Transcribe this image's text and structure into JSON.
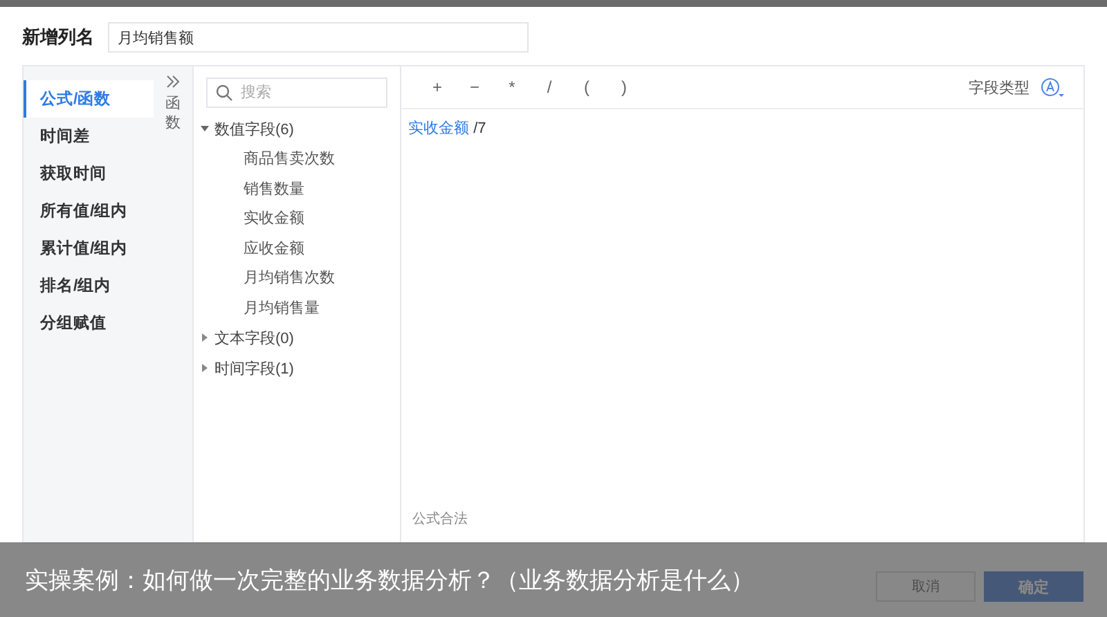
{
  "name_field": {
    "label": "新增列名",
    "value": "月均销售额"
  },
  "categories": [
    {
      "label": "公式/函数",
      "selected": true
    },
    {
      "label": "时间差",
      "selected": false
    },
    {
      "label": "获取时间",
      "selected": false
    },
    {
      "label": "所有值/组内",
      "selected": false
    },
    {
      "label": "累计值/组内",
      "selected": false
    },
    {
      "label": "排名/组内",
      "selected": false
    },
    {
      "label": "分组赋值",
      "selected": false
    }
  ],
  "function_panel": {
    "label": "函数"
  },
  "search": {
    "placeholder": "搜索"
  },
  "field_tree": [
    {
      "label": "数值字段(6)",
      "expanded": true,
      "children": [
        {
          "label": "商品售卖次数"
        },
        {
          "label": "销售数量"
        },
        {
          "label": "实收金额"
        },
        {
          "label": "应收金额"
        },
        {
          "label": "月均销售次数"
        },
        {
          "label": "月均销售量"
        }
      ]
    },
    {
      "label": "文本字段(0)",
      "expanded": false
    },
    {
      "label": "时间字段(1)",
      "expanded": false
    }
  ],
  "operators": [
    "+",
    "−",
    "*",
    "/",
    "(",
    ")"
  ],
  "field_type_label": "字段类型",
  "formula": {
    "field": "实收金额",
    "rest": "/7"
  },
  "status": "公式合法",
  "buttons": [
    {
      "label": "取消",
      "kind": "secondary"
    },
    {
      "label": "确定",
      "kind": "primary"
    }
  ],
  "caption": "实操案例：如何做一次完整的业务数据分析？（业务数据分析是什么）"
}
